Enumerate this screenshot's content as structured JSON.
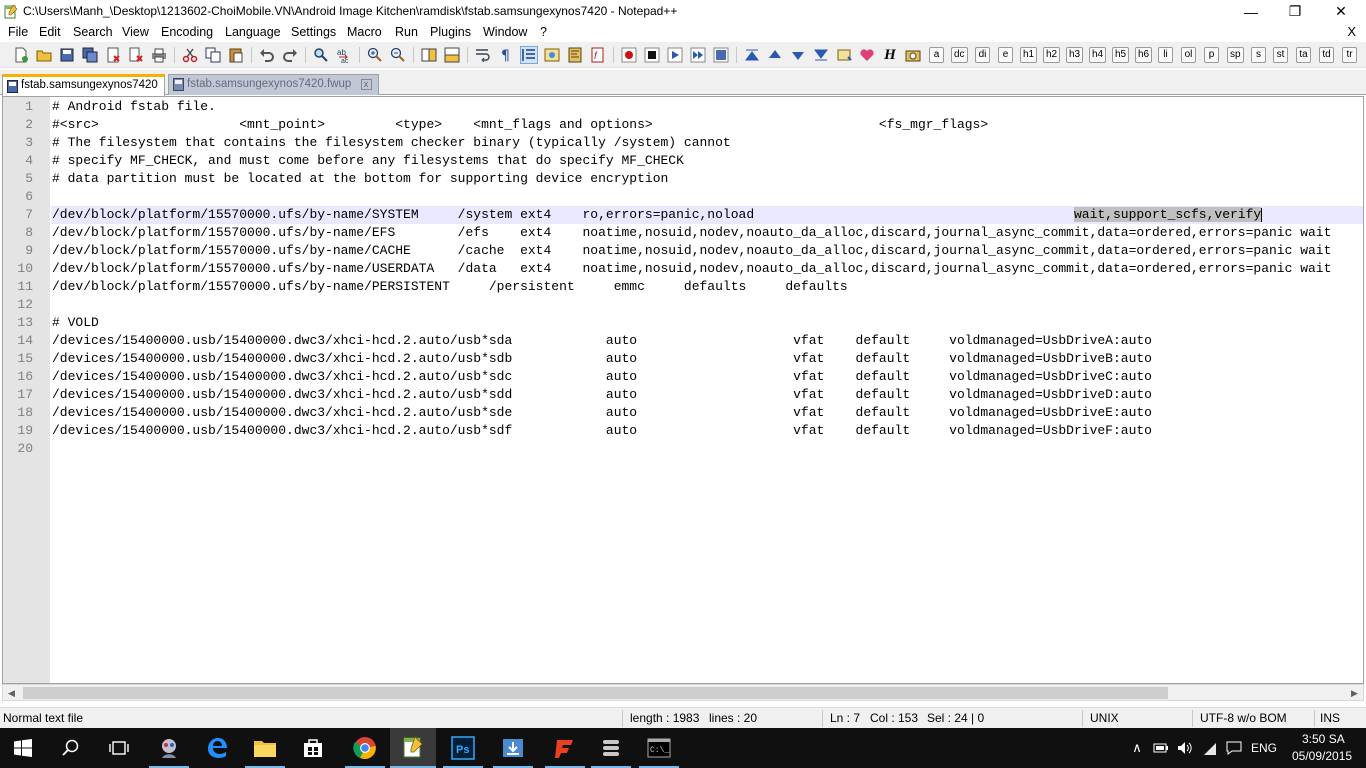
{
  "window": {
    "title": "C:\\Users\\Manh_\\Desktop\\1213602-ChoiMobile.VN\\Android Image Kitchen\\ramdisk\\fstab.samsungexynos7420 - Notepad++",
    "minimize_glyph": "—",
    "maximize_glyph": "❐",
    "close_glyph": "✕"
  },
  "menu": {
    "items": [
      "File",
      "Edit",
      "Search",
      "View",
      "Encoding",
      "Language",
      "Settings",
      "Macro",
      "Run",
      "Plugins",
      "Window",
      "?"
    ],
    "close_glyph": "X"
  },
  "toolbar": {
    "tag_buttons": [
      "a",
      "dc",
      "di",
      "e",
      "h1",
      "h2",
      "h3",
      "h4",
      "h5",
      "h6",
      "li",
      "ol",
      "p",
      "sp",
      "s",
      "st",
      "ta",
      "td",
      "tr"
    ],
    "italic_h": "H"
  },
  "tabs": [
    {
      "label": "fstab.samsungexynos7420",
      "active": true
    },
    {
      "label": "fstab.samsungexynos7420.fwup",
      "active": false
    }
  ],
  "tab_close_glyph": "x",
  "editor": {
    "lines": [
      "# Android fstab file.",
      "#<src>                  <mnt_point>         <type>    <mnt_flags and options>                             <fs_mgr_flags>",
      "# The filesystem that contains the filesystem checker binary (typically /system) cannot",
      "# specify MF_CHECK, and must come before any filesystems that do specify MF_CHECK",
      "# data partition must be located at the bottom for supporting device encryption",
      "",
      "/dev/block/platform/15570000.ufs/by-name/SYSTEM     /system ext4    ro,errors=panic,noload                                         ",
      "/dev/block/platform/15570000.ufs/by-name/EFS        /efs    ext4    noatime,nosuid,nodev,noauto_da_alloc,discard,journal_async_commit,data=ordered,errors=panic wait",
      "/dev/block/platform/15570000.ufs/by-name/CACHE      /cache  ext4    noatime,nosuid,nodev,noauto_da_alloc,discard,journal_async_commit,data=ordered,errors=panic wait",
      "/dev/block/platform/15570000.ufs/by-name/USERDATA   /data   ext4    noatime,nosuid,nodev,noauto_da_alloc,discard,journal_async_commit,data=ordered,errors=panic wait",
      "/dev/block/platform/15570000.ufs/by-name/PERSISTENT     /persistent     emmc     defaults     defaults",
      "",
      "# VOLD",
      "/devices/15400000.usb/15400000.dwc3/xhci-hcd.2.auto/usb*sda            auto                    vfat    default     voldmanaged=UsbDriveA:auto",
      "/devices/15400000.usb/15400000.dwc3/xhci-hcd.2.auto/usb*sdb            auto                    vfat    default     voldmanaged=UsbDriveB:auto",
      "/devices/15400000.usb/15400000.dwc3/xhci-hcd.2.auto/usb*sdc            auto                    vfat    default     voldmanaged=UsbDriveC:auto",
      "/devices/15400000.usb/15400000.dwc3/xhci-hcd.2.auto/usb*sdd            auto                    vfat    default     voldmanaged=UsbDriveD:auto",
      "/devices/15400000.usb/15400000.dwc3/xhci-hcd.2.auto/usb*sde            auto                    vfat    default     voldmanaged=UsbDriveE:auto",
      "/devices/15400000.usb/15400000.dwc3/xhci-hcd.2.auto/usb*sdf            auto                    vfat    default     voldmanaged=UsbDriveF:auto",
      ""
    ],
    "line_numbers": [
      "1",
      "2",
      "3",
      "4",
      "5",
      "6",
      "7",
      "8",
      "9",
      "10",
      "11",
      "12",
      "13",
      "14",
      "15",
      "16",
      "17",
      "18",
      "19",
      "20"
    ],
    "current_line": 7,
    "selected_text": "wait,support_scfs,verify"
  },
  "scrollbar": {
    "left_arrow": "◀",
    "right_arrow": "▶"
  },
  "status": {
    "file_type": "Normal text file",
    "length": "length : 1983",
    "lines": "lines : 20",
    "ln": "Ln : 7",
    "col": "Col : 153",
    "sel": "Sel : 24 | 0",
    "eol": "UNIX",
    "encoding": "UTF-8 w/o BOM",
    "mode": "INS"
  },
  "taskbar": {
    "time": "3:50 SA",
    "date": "05/09/2015",
    "language": "ENG",
    "apps": [
      "start",
      "search",
      "task-view",
      "avatar-app",
      "edge",
      "file-explorer",
      "store",
      "chrome",
      "notepad-plus-plus",
      "photoshop",
      "downloader",
      "foxit",
      "stack-app",
      "cmd"
    ]
  }
}
